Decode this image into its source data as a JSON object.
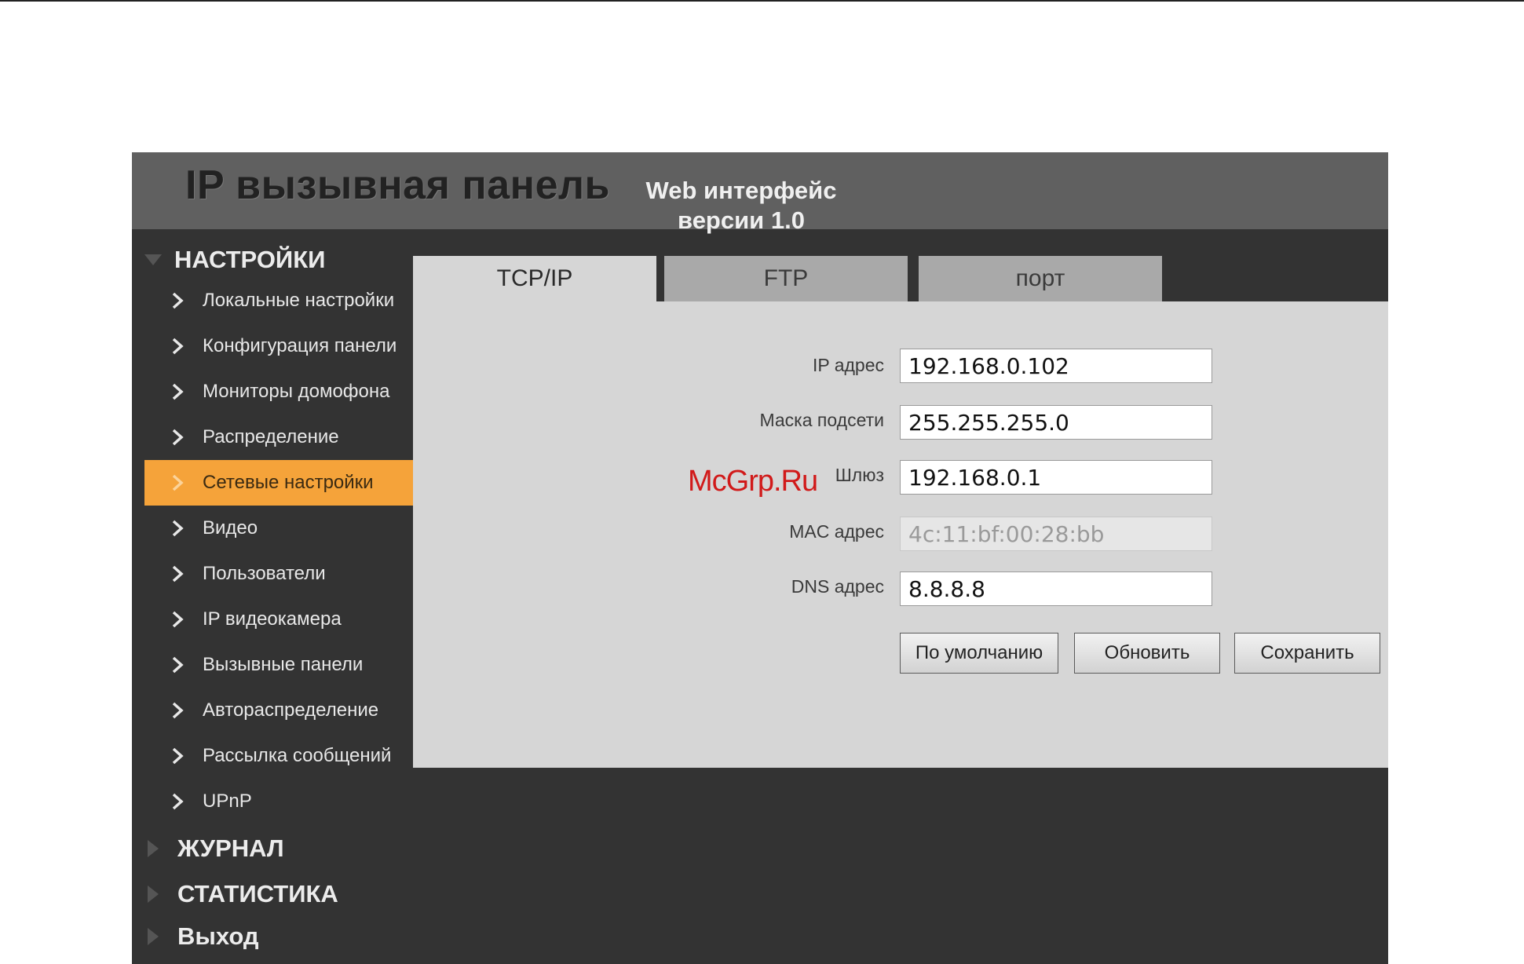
{
  "header": {
    "title": "IP вызывная панель",
    "subtitle_line1": "Web интерфейс",
    "subtitle_line2": "версии 1.0"
  },
  "sidebar": {
    "settings_section": "НАСТРОЙКИ",
    "items": [
      {
        "label": "Локальные настройки"
      },
      {
        "label": "Конфигурация панели"
      },
      {
        "label": "Мониторы домофона"
      },
      {
        "label": "Распределение"
      },
      {
        "label": "Сетевые настройки",
        "active": true
      },
      {
        "label": "Видео"
      },
      {
        "label": "Пользователи"
      },
      {
        "label": "IP видеокамера"
      },
      {
        "label": "Вызывные панели"
      },
      {
        "label": "Автораспределение"
      },
      {
        "label": "Рассылка сообщений"
      },
      {
        "label": "UPnP"
      }
    ],
    "journal_section": "ЖУРНАЛ",
    "stats_section": "СТАТИСТИКА",
    "exit_section": "Выход"
  },
  "tabs": [
    {
      "label": "TCP/IP",
      "active": true
    },
    {
      "label": "FTP"
    },
    {
      "label": "порт"
    }
  ],
  "form": {
    "ip_label": "IP адрес",
    "ip_value": "192.168.0.102",
    "mask_label": "Маска подсети",
    "mask_value": "255.255.255.0",
    "gateway_label": "Шлюз",
    "gateway_value": "192.168.0.1",
    "mac_label": "MAC адрес",
    "mac_value": "4c:11:bf:00:28:bb",
    "dns_label": "DNS адрес",
    "dns_value": "8.8.8.8"
  },
  "buttons": {
    "default_label": "По умолчанию",
    "refresh_label": "Обновить",
    "save_label": "Сохранить"
  },
  "watermark": "McGrp.Ru",
  "colors": {
    "accent": "#f5a33a",
    "header_bg": "#606060",
    "sidebar_bg": "#333333",
    "panel_bg": "#d6d6d6"
  }
}
